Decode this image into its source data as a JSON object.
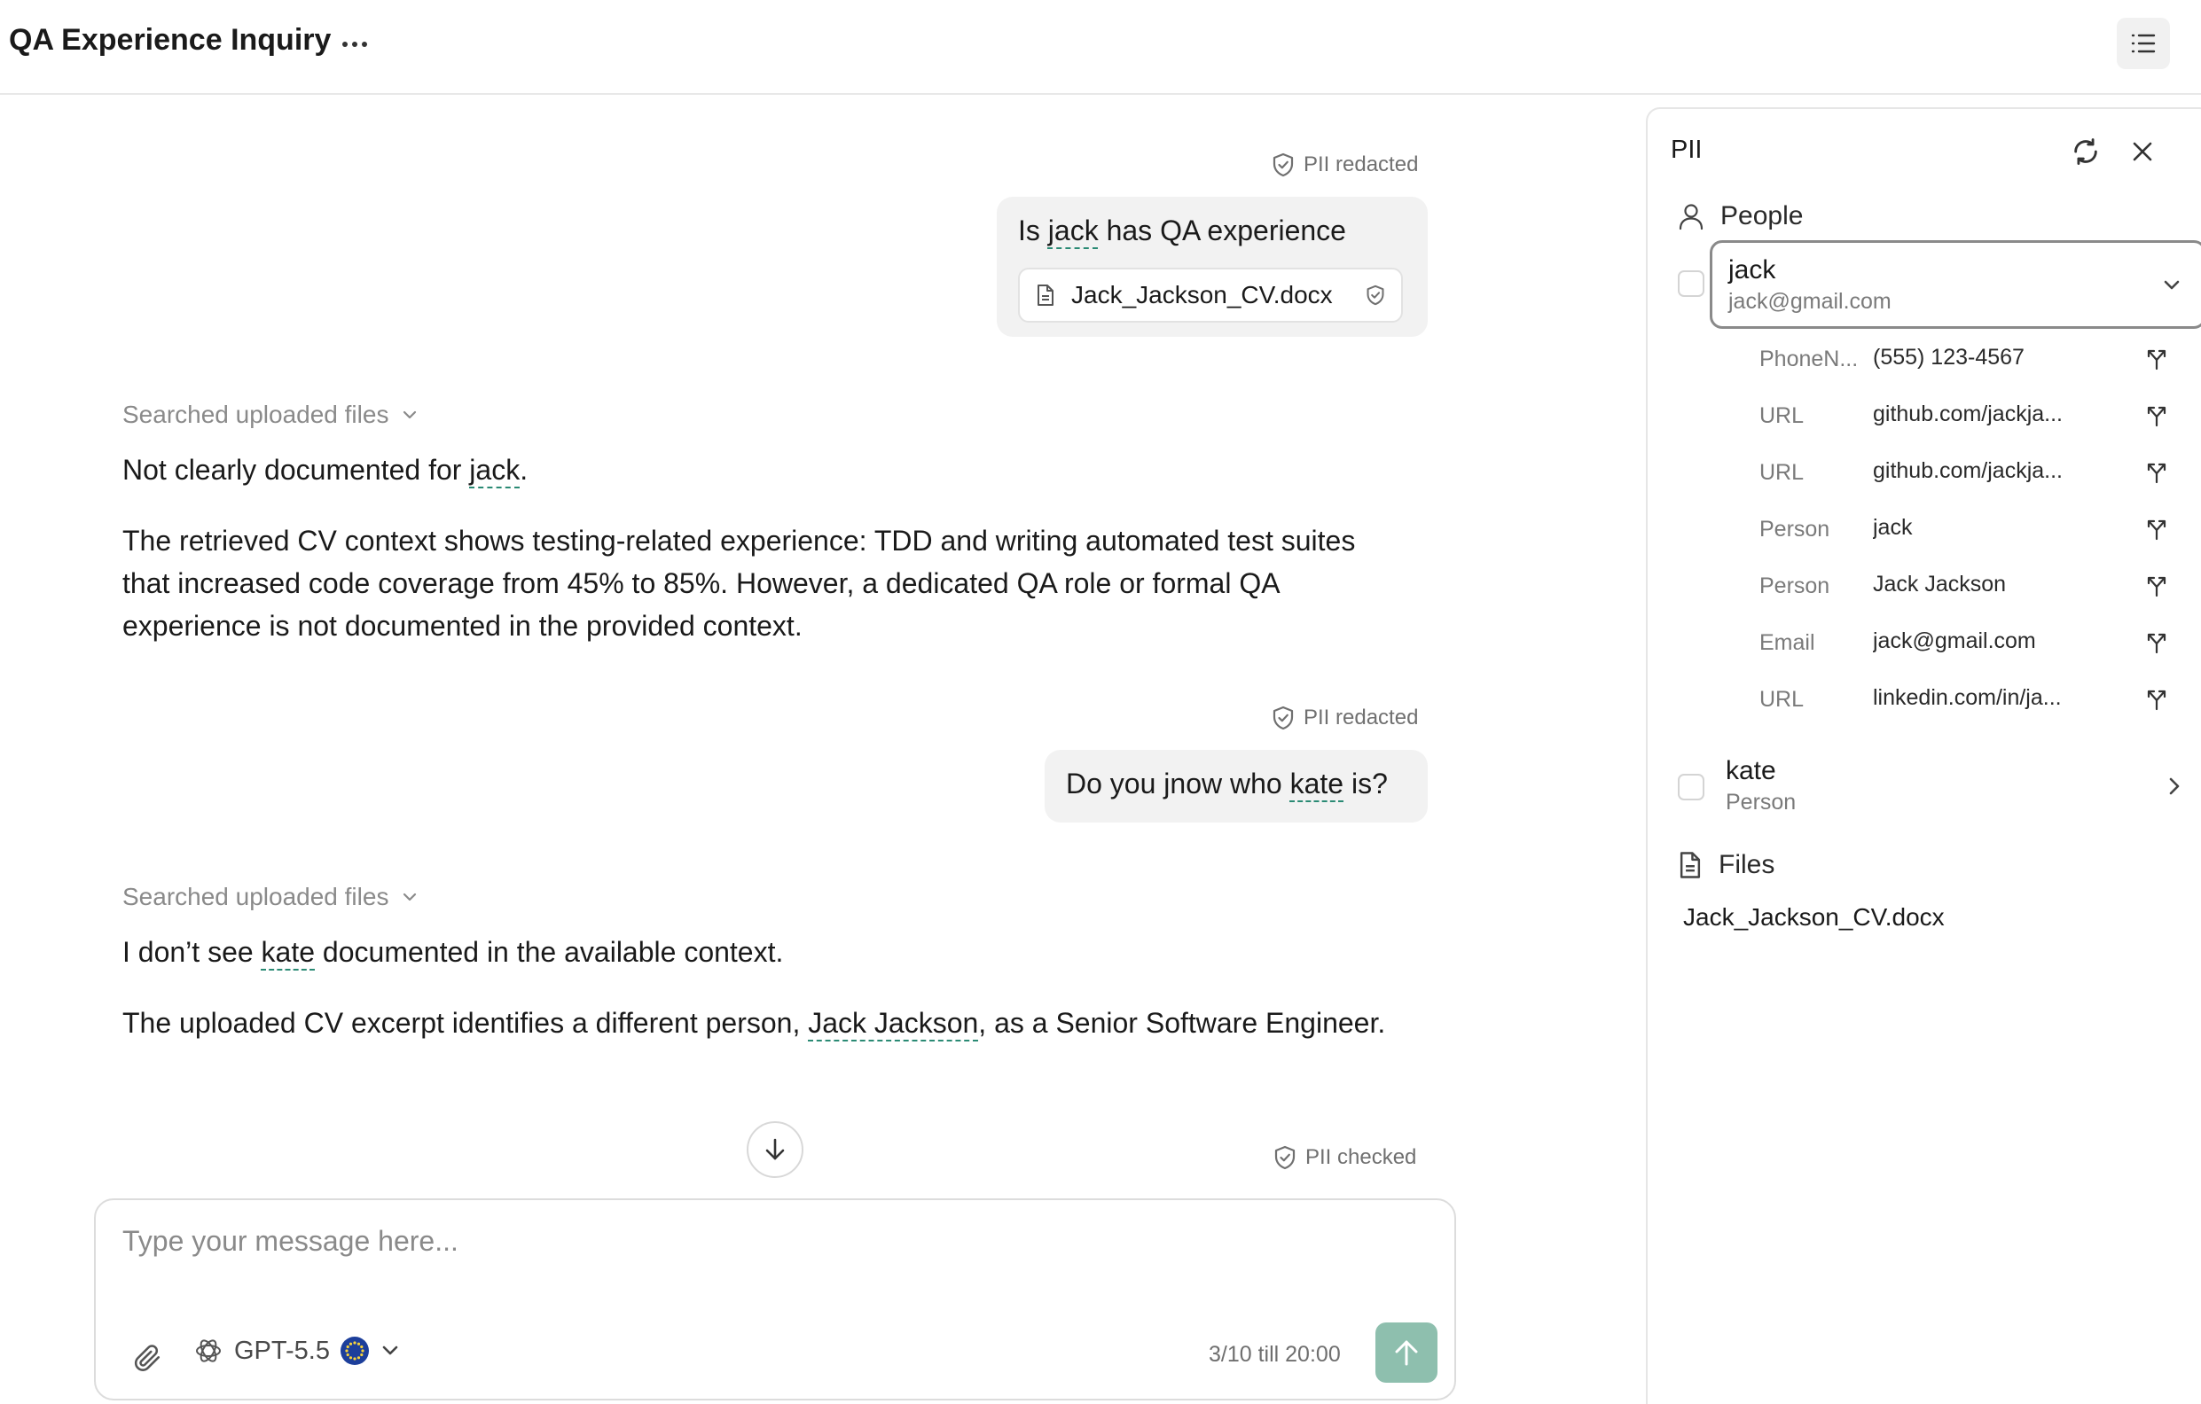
{
  "header": {
    "title": "QA Experience Inquiry"
  },
  "messages": {
    "m1": {
      "pii": "PII redacted",
      "before": "Is ",
      "entity": "jack",
      "after": " has QA experience",
      "file": "Jack_Jackson_CV.docx"
    },
    "a1": {
      "searched": "Searched uploaded files",
      "p1_before": "Not clearly documented for ",
      "p1_entity": "jack",
      "p1_after": ".",
      "p2": "The retrieved CV context shows testing-related experience: TDD and writing automated test suites that increased code coverage from 45% to 85%. However, a dedicated QA role or formal QA experience is not documented in the provided context."
    },
    "m2": {
      "pii": "PII redacted",
      "before": "Do you jnow who ",
      "entity": "kate",
      "after": " is?"
    },
    "a2": {
      "searched": "Searched uploaded files",
      "p1_before": "I don’t see ",
      "p1_entity": "kate",
      "p1_after": " documented in the available context.",
      "p2_before": "The uploaded CV excerpt identifies a different person, ",
      "p2_entity": "Jack Jackson",
      "p2_after": ", as a Senior Software Engineer."
    },
    "m3": {
      "pii": "PII checked"
    }
  },
  "composer": {
    "placeholder": "Type your message here...",
    "model": "GPT-5.5",
    "quota": "3/10 till 20:00"
  },
  "panel": {
    "title": "PII",
    "people_heading": "People",
    "files_heading": "Files",
    "jack": {
      "name": "jack",
      "email": "jack@gmail.com",
      "entities": [
        {
          "type": "PhoneN...",
          "value": "(555) 123-4567"
        },
        {
          "type": "URL",
          "value": "github.com/jackja..."
        },
        {
          "type": "URL",
          "value": "github.com/jackja..."
        },
        {
          "type": "Person",
          "value": "jack"
        },
        {
          "type": "Person",
          "value": "Jack Jackson"
        },
        {
          "type": "Email",
          "value": "jack@gmail.com"
        },
        {
          "type": "URL",
          "value": "linkedin.com/in/ja..."
        }
      ]
    },
    "kate": {
      "name": "kate",
      "type": "Person"
    },
    "files": [
      "Jack_Jackson_CV.docx"
    ]
  },
  "colors": {
    "accent": "#2a8a74",
    "send_button": "#8ebfae",
    "bubble": "#f2f2f2"
  }
}
